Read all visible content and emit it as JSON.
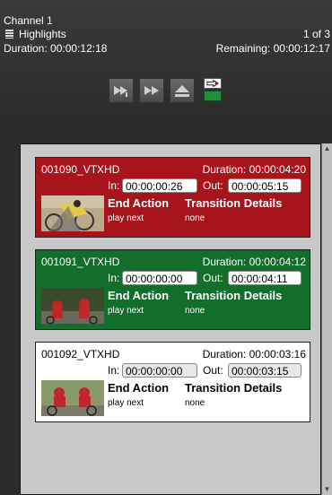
{
  "header": {
    "channel": "Channel 1",
    "playlist": "Highlights",
    "position": "1 of 3",
    "duration": "Duration: 00:00:12:18",
    "remaining": "Remaining: 00:00:12:17"
  },
  "toolbar": {
    "icons": [
      "skip-next-icon",
      "fast-forward-icon",
      "eject-icon",
      "output-status-icon"
    ]
  },
  "clips": [
    {
      "name": "001090_VTXHD",
      "duration": "Duration: 00:00:04:20",
      "in_label": "In:",
      "in": "00:00:00:26",
      "out_label": "Out:",
      "out": "00:00:05:15",
      "end_action_label": "End Action",
      "end_action": "play next",
      "transition_label": "Transition Details",
      "transition": "none",
      "state_color": "#a8141c"
    },
    {
      "name": "001091_VTXHD",
      "duration": "Duration: 00:00:04:12",
      "in_label": "In:",
      "in": "00:00:00:00",
      "out_label": "Out:",
      "out": "00:00:04:11",
      "end_action_label": "End Action",
      "end_action": "play next",
      "transition_label": "Transition Details",
      "transition": "none",
      "state_color": "#136e2b"
    },
    {
      "name": "001092_VTXHD",
      "duration": "Duration: 00:00:03:16",
      "in_label": "In:",
      "in": "00:00:00:00",
      "out_label": "Out:",
      "out": "00:00:03:15",
      "end_action_label": "End Action",
      "end_action": "play next",
      "transition_label": "Transition Details",
      "transition": "none",
      "state_color": "#ffffff"
    }
  ]
}
